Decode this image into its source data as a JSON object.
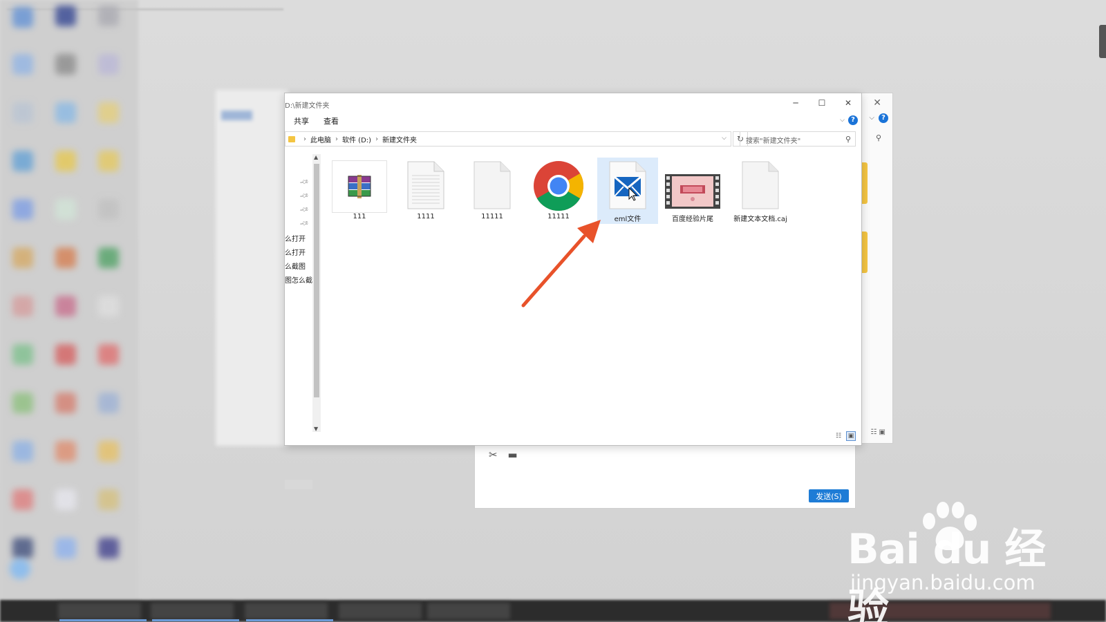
{
  "explorer": {
    "title_path": "D:\\新建文件夹",
    "ribbon": {
      "share": "共享",
      "view": "查看",
      "help": "?"
    },
    "breadcrumb": [
      "此电脑",
      "软件 (D:)",
      "新建文件夹"
    ],
    "search_placeholder": "搜索\"新建文件夹\"",
    "nav_labels": [
      "么打开",
      "么打开",
      "么截图",
      "图怎么截"
    ],
    "files": [
      {
        "name": "111",
        "icon": "winrar-archive-icon"
      },
      {
        "name": "1111",
        "icon": "text-document-icon"
      },
      {
        "name": "11111",
        "icon": "blank-file-icon"
      },
      {
        "name": "11111",
        "icon": "chrome-icon"
      },
      {
        "name": "eml文件",
        "icon": "mail-icon",
        "selected": true
      },
      {
        "name": "百度经验片尾",
        "icon": "video-file-icon"
      },
      {
        "name": "新建文本文档.caj",
        "icon": "blank-file-icon"
      }
    ]
  },
  "back_window": {
    "help": "?"
  },
  "chat": {
    "send_label": "发送(S)"
  },
  "watermark": {
    "brand": "Bai du 经验",
    "url": "jingyan.baidu.com"
  },
  "colors": {
    "accent": "#1e7cd6",
    "selection": "#dcebfb",
    "arrow": "#e8522a"
  }
}
